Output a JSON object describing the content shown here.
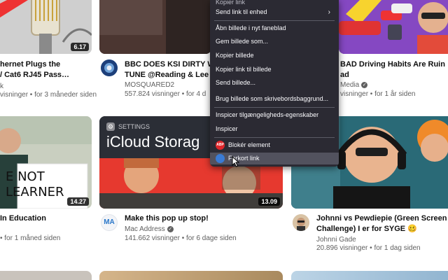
{
  "videos": [
    {
      "title1": "hernet Plugs the",
      "title2": "/ Cat6 RJ45 Pass…",
      "channel": "k",
      "stats": "visninger • for 3 måneder siden",
      "duration": "6.17"
    },
    {
      "title1": "BBC DOES KSI DIRTY W",
      "title2": "TUNE @Reading & Lee",
      "channel": "MOSQUARED2",
      "stats": "557.824 visninger • for 4 d"
    },
    {
      "title1": "BAD Driving Habits Are Ruin",
      "title2": "ad",
      "channel": "Media",
      "stats": "visninger • for 1 år siden"
    },
    {
      "title1": "In Education",
      "stats": "• for 1 måned siden",
      "duration": "14.27",
      "sign1": "E NOT",
      "sign2": "LEARNER"
    },
    {
      "title1": "Make this pop up stop!",
      "channel": "Mac Address",
      "stats": "141.662 visninger • for 6 dage siden",
      "duration": "13.09",
      "overlay_small": "SETTINGS",
      "overlay_big": "iCloud Storag",
      "avatar_text": "MA"
    },
    {
      "title1": "Johnni vs Pewdiepie (Green Screen",
      "title2": "Challenge) I er for SYGE 🥴",
      "channel": "Johnni Gade",
      "stats": "20.896 visninger • for 1 dag siden"
    }
  ],
  "context_menu": {
    "items": [
      {
        "label": "Kopier link",
        "y": -4
      },
      {
        "label": "Send link til enhed",
        "submenu": true
      },
      {
        "label": "Åbn billede i nyt faneblad"
      },
      {
        "label": "Gem billede som..."
      },
      {
        "label": "Kopier billede"
      },
      {
        "label": "Kopier link til billede"
      },
      {
        "label": "Send billede..."
      },
      {
        "label": "Brug billede som skrivebordsbaggrund..."
      },
      {
        "label": "Inspicer tilgængeligheds-egenskaber"
      },
      {
        "label": "Inspicer"
      },
      {
        "label": "Blokér element",
        "icon_text": "ABP"
      },
      {
        "label": "Forkort link",
        "highlighted": true
      }
    ]
  },
  "colors": {
    "menu_bg": "#2b2a33",
    "menu_highlight": "#52525e",
    "abp_red": "#e0262b"
  }
}
